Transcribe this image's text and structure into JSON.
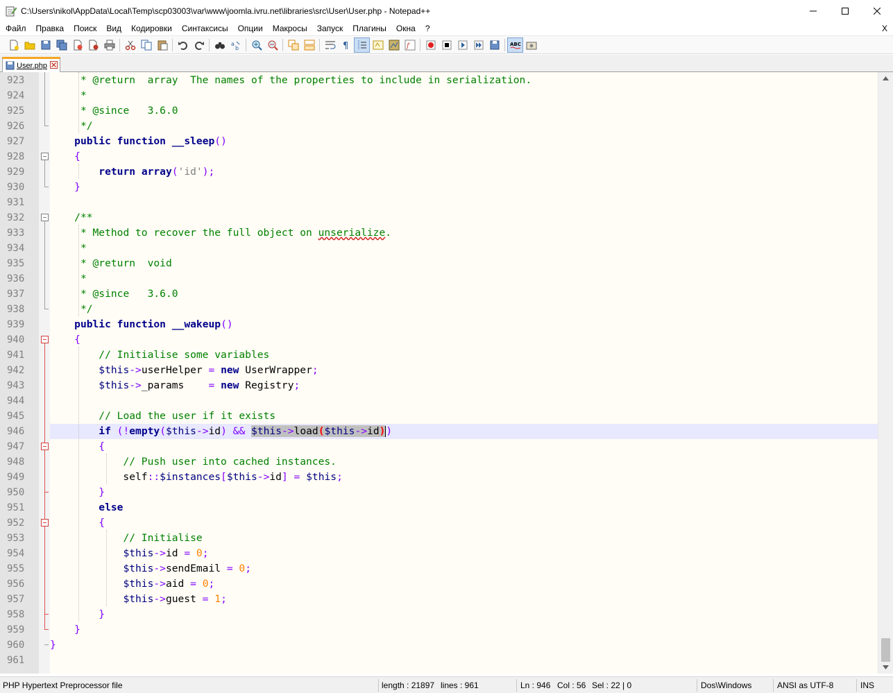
{
  "window": {
    "title": "C:\\Users\\nikol\\AppData\\Local\\Temp\\scp03003\\var\\www\\joomla.ivru.net\\libraries\\src\\User\\User.php - Notepad++"
  },
  "menu": {
    "items": [
      "Файл",
      "Правка",
      "Поиск",
      "Вид",
      "Кодировки",
      "Синтаксисы",
      "Опции",
      "Макросы",
      "Запуск",
      "Плагины",
      "Окна",
      "?"
    ],
    "close": "X"
  },
  "tabs": [
    {
      "label": "User.php",
      "active": true
    }
  ],
  "editor": {
    "first_line": 923,
    "current_line": 946
  },
  "status": {
    "filetype": "PHP Hypertext Preprocessor file",
    "length": "length : 21897",
    "lines": "lines : 961",
    "ln": "Ln : 946",
    "col": "Col : 56",
    "sel": "Sel : 22 | 0",
    "eol": "Dos\\Windows",
    "encoding": "ANSI as UTF-8",
    "mode": "INS"
  },
  "colors": {
    "comment": "#008000",
    "keyword": "#00008b",
    "operator": "#8000ff",
    "number": "#ff8000",
    "current_line": "#e8e8ff",
    "tab_accent": "#f5a623"
  },
  "code_lines": [
    {
      "n": "923",
      "html": "     <span class='cm'>* @return  array  The names of the properties to include in serialization.</span>"
    },
    {
      "n": "924",
      "html": "     <span class='cm'>*</span>"
    },
    {
      "n": "925",
      "html": "     <span class='cm'>* @since   3.6.0</span>"
    },
    {
      "n": "926",
      "html": "     <span class='cm'>*/</span>"
    },
    {
      "n": "927",
      "html": "    <span class='kw'>public</span> <span class='kw'>function</span> <span class='kw'>__sleep</span><span class='op'>()</span>"
    },
    {
      "n": "928",
      "html": "    <span class='op'>{</span>"
    },
    {
      "n": "929",
      "html": "        <span class='kw'>return</span> <span class='kw'>array</span><span class='op'>(</span><span class='str'>'id'</span><span class='op'>);</span>"
    },
    {
      "n": "930",
      "html": "    <span class='op'>}</span>"
    },
    {
      "n": "931",
      "html": ""
    },
    {
      "n": "932",
      "html": "    <span class='cm'>/**</span>"
    },
    {
      "n": "933",
      "html": "     <span class='cm'>* Method to recover the full object on <span class='sq'>unserialize</span>.</span>"
    },
    {
      "n": "934",
      "html": "     <span class='cm'>*</span>"
    },
    {
      "n": "935",
      "html": "     <span class='cm'>* @return  void</span>"
    },
    {
      "n": "936",
      "html": "     <span class='cm'>*</span>"
    },
    {
      "n": "937",
      "html": "     <span class='cm'>* @since   3.6.0</span>"
    },
    {
      "n": "938",
      "html": "     <span class='cm'>*/</span>"
    },
    {
      "n": "939",
      "html": "    <span class='kw'>public</span> <span class='kw'>function</span> <span class='kw'>__wakeup</span><span class='op'>()</span>"
    },
    {
      "n": "940",
      "html": "    <span class='op'>{</span>"
    },
    {
      "n": "941",
      "html": "        <span class='cm'>// Initialise some variables</span>"
    },
    {
      "n": "942",
      "html": "        <span class='var'>$this</span><span class='op'>-&gt;</span>userHelper <span class='op'>=</span> <span class='kw'>new</span> UserWrapper<span class='op'>;</span>"
    },
    {
      "n": "943",
      "html": "        <span class='var'>$this</span><span class='op'>-&gt;</span>_params    <span class='op'>=</span> <span class='kw'>new</span> Registry<span class='op'>;</span>"
    },
    {
      "n": "944",
      "html": ""
    },
    {
      "n": "945",
      "html": "        <span class='cm'>// Load the user if it exists</span>"
    },
    {
      "n": "946",
      "html": "        <span class='kw'>if</span> <span class='op'>(!</span><span class='kw'>empty</span><span class='op'>(</span><span class='var'>$this</span><span class='op'>-&gt;</span>id<span class='op'>)</span> <span class='op'>&amp;&amp;</span> <span class='hl'><span class='var'>$this</span><span class='op'>-&gt;</span>load<span class='brace-hl'>(</span><span class='var'>$this</span><span class='op'>-&gt;</span>id<span class='brace-hl'>)</span></span><span class='caret'></span><span class='op'>)</span>"
    },
    {
      "n": "947",
      "html": "        <span class='op'>{</span>"
    },
    {
      "n": "948",
      "html": "            <span class='cm'>// Push user into cached instances.</span>"
    },
    {
      "n": "949",
      "html": "            self<span class='op'>::</span><span class='var'>$instances</span><span class='op'>[</span><span class='var'>$this</span><span class='op'>-&gt;</span>id<span class='op'>]</span> <span class='op'>=</span> <span class='var'>$this</span><span class='op'>;</span>"
    },
    {
      "n": "950",
      "html": "        <span class='op'>}</span>"
    },
    {
      "n": "951",
      "html": "        <span class='kw'>else</span>"
    },
    {
      "n": "952",
      "html": "        <span class='op'>{</span>"
    },
    {
      "n": "953",
      "html": "            <span class='cm'>// Initialise</span>"
    },
    {
      "n": "954",
      "html": "            <span class='var'>$this</span><span class='op'>-&gt;</span>id <span class='op'>=</span> <span class='num'>0</span><span class='op'>;</span>"
    },
    {
      "n": "955",
      "html": "            <span class='var'>$this</span><span class='op'>-&gt;</span>sendEmail <span class='op'>=</span> <span class='num'>0</span><span class='op'>;</span>"
    },
    {
      "n": "956",
      "html": "            <span class='var'>$this</span><span class='op'>-&gt;</span>aid <span class='op'>=</span> <span class='num'>0</span><span class='op'>;</span>"
    },
    {
      "n": "957",
      "html": "            <span class='var'>$this</span><span class='op'>-&gt;</span>guest <span class='op'>=</span> <span class='num'>1</span><span class='op'>;</span>"
    },
    {
      "n": "958",
      "html": "        <span class='op'>}</span>"
    },
    {
      "n": "959",
      "html": "    <span class='op'>}</span>"
    },
    {
      "n": "960",
      "html": "<span class='op'>}</span>"
    },
    {
      "n": "961",
      "html": ""
    }
  ]
}
